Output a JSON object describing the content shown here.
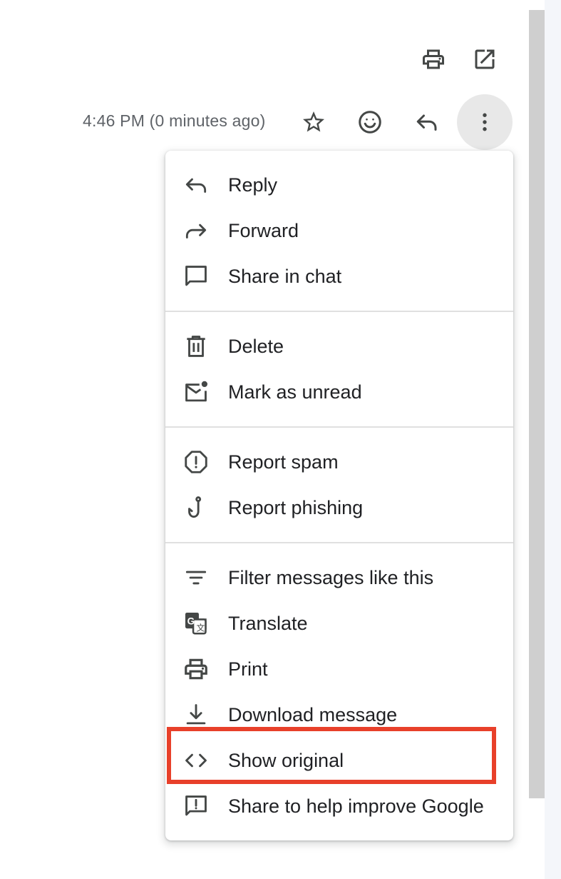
{
  "toolbar": {
    "icons": [
      "print-icon",
      "open-in-new-window-icon"
    ]
  },
  "message_header": {
    "timestamp": "4:46 PM (0 minutes ago)",
    "actions": [
      "star-icon",
      "emoji-reaction-icon",
      "reply-icon",
      "more-vert-icon"
    ]
  },
  "menu": {
    "groups": [
      [
        {
          "label": "Reply",
          "icon": "reply-icon"
        },
        {
          "label": "Forward",
          "icon": "forward-icon"
        },
        {
          "label": "Share in chat",
          "icon": "chat-bubble-icon"
        }
      ],
      [
        {
          "label": "Delete",
          "icon": "trash-icon"
        },
        {
          "label": "Mark as unread",
          "icon": "mark-unread-icon"
        }
      ],
      [
        {
          "label": "Report spam",
          "icon": "report-icon"
        },
        {
          "label": "Report phishing",
          "icon": "phishing-hook-icon"
        }
      ],
      [
        {
          "label": "Filter messages like this",
          "icon": "filter-icon"
        },
        {
          "label": "Translate",
          "icon": "translate-icon"
        },
        {
          "label": "Print",
          "icon": "print-icon"
        },
        {
          "label": "Download message",
          "icon": "download-icon"
        },
        {
          "label": "Show original",
          "icon": "code-icon"
        },
        {
          "label": "Share to help improve Google",
          "icon": "feedback-icon"
        }
      ]
    ]
  },
  "colors": {
    "highlight": "#e8402a",
    "icon": "#444746",
    "text": "#202124",
    "muted_text": "#5f6368"
  }
}
